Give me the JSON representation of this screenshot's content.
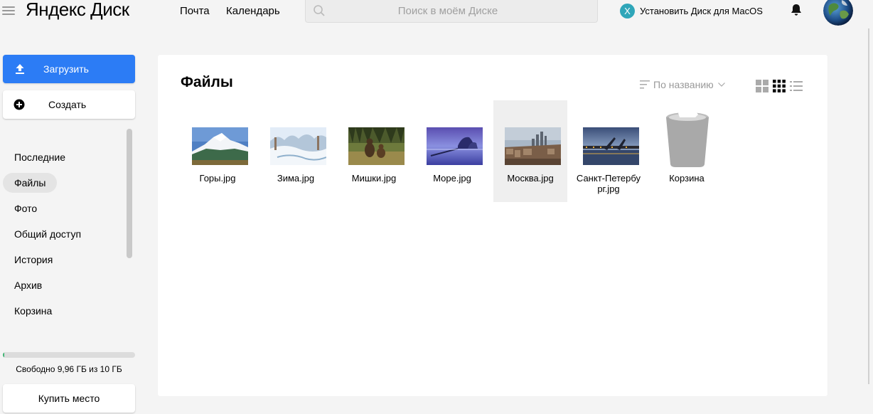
{
  "header": {
    "logo": "Яндекс Диск",
    "nav": [
      {
        "label": "Почта"
      },
      {
        "label": "Календарь"
      }
    ],
    "search": {
      "placeholder": "Поиск в моём Диске",
      "value": ""
    },
    "install": {
      "badge": "X",
      "label": "Установить Диск для MacOS"
    }
  },
  "sidebar": {
    "upload_label": "Загрузить",
    "create_label": "Создать",
    "items": [
      {
        "label": "Последние",
        "active": false
      },
      {
        "label": "Файлы",
        "active": true
      },
      {
        "label": "Фото",
        "active": false
      },
      {
        "label": "Общий доступ",
        "active": false
      },
      {
        "label": "История",
        "active": false
      },
      {
        "label": "Архив",
        "active": false
      },
      {
        "label": "Корзина",
        "active": false
      }
    ],
    "quota": {
      "text": "Свободно 9,96 ГБ из 10 ГБ",
      "used_fraction": 0.004
    },
    "buy_label": "Купить место"
  },
  "main": {
    "title": "Файлы",
    "sort_label": "По названию",
    "files": [
      {
        "name": "Горы.jpg",
        "thumb": "mountains"
      },
      {
        "name": "Зима.jpg",
        "thumb": "winter"
      },
      {
        "name": "Мишки.jpg",
        "thumb": "bears"
      },
      {
        "name": "Море.jpg",
        "thumb": "sea"
      },
      {
        "name": "Москва.jpg",
        "thumb": "moscow",
        "selected": true
      },
      {
        "name": "Санкт-Петербург.jpg",
        "thumb": "spb"
      },
      {
        "name": "Корзина",
        "thumb": "trash-icon"
      }
    ]
  },
  "colors": {
    "accent": "#2c7cf5",
    "badge": "#2fa6b9",
    "quota": "#3cb371"
  }
}
